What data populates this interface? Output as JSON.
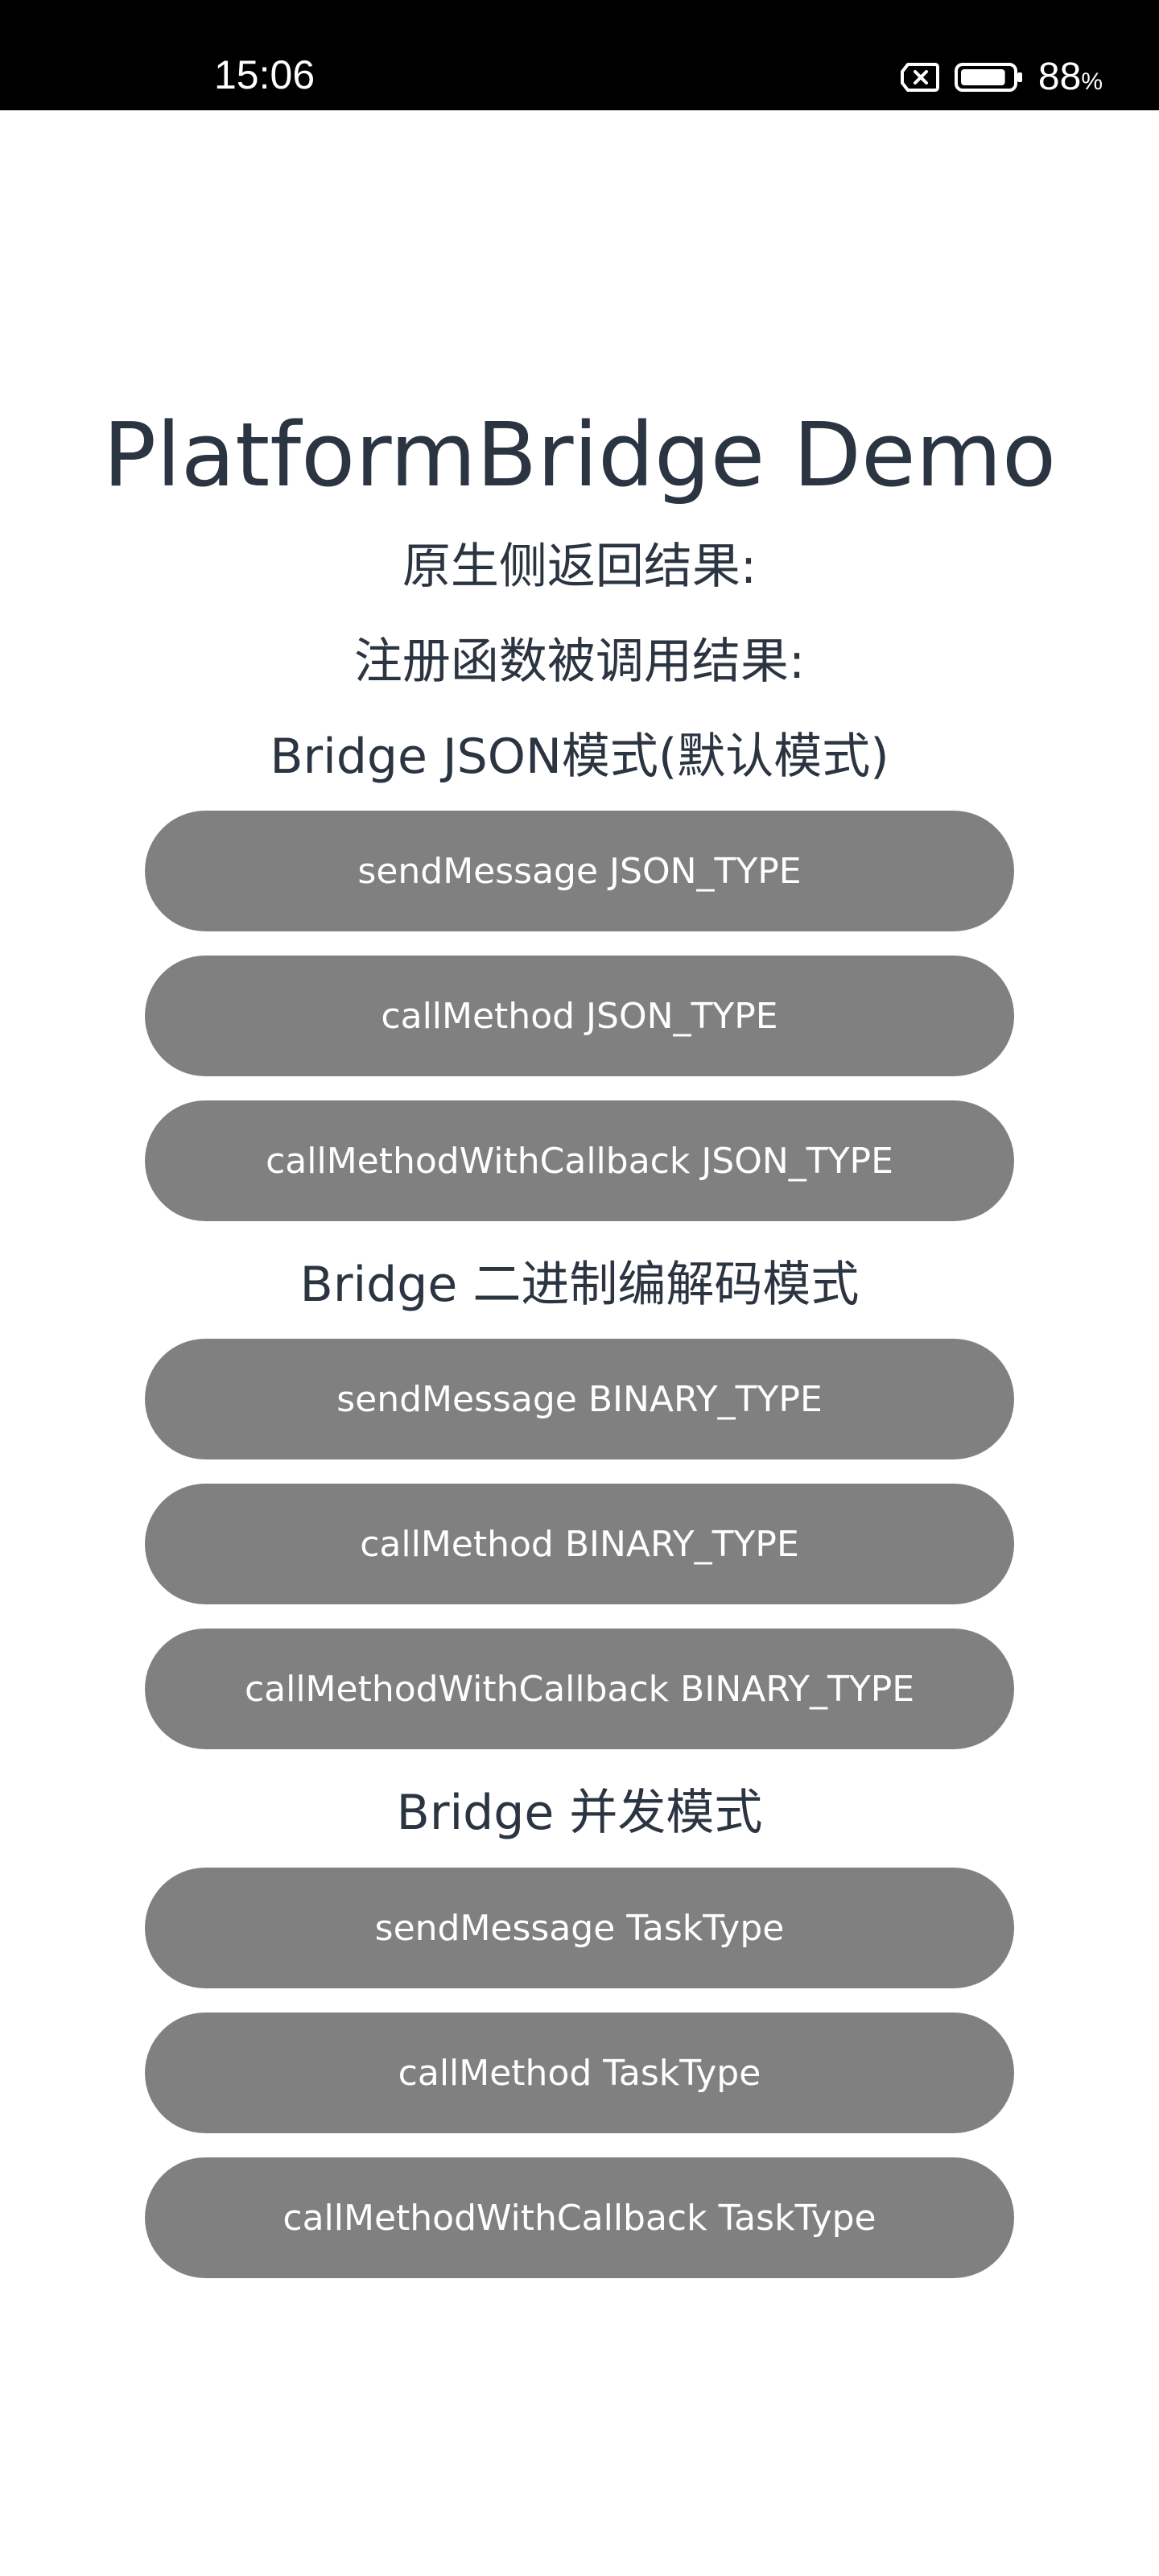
{
  "status_bar": {
    "time": "15:06",
    "battery_level": "88",
    "battery_unit": "%",
    "battery_fraction": 0.88,
    "icons": [
      "no-sim-icon",
      "battery-icon"
    ]
  },
  "page": {
    "title": "PlatformBridge Demo",
    "native_result_label": "原生侧返回结果:",
    "registered_result_label": "注册函数被调用结果:"
  },
  "sections": [
    {
      "heading": "Bridge JSON模式(默认模式)",
      "buttons": [
        "sendMessage JSON_TYPE",
        "callMethod JSON_TYPE",
        "callMethodWithCallback JSON_TYPE"
      ]
    },
    {
      "heading": "Bridge 二进制编解码模式",
      "buttons": [
        "sendMessage BINARY_TYPE",
        "callMethod BINARY_TYPE",
        "callMethodWithCallback BINARY_TYPE"
      ]
    },
    {
      "heading": "Bridge 并发模式",
      "buttons": [
        "sendMessage TaskType",
        "callMethod TaskType",
        "callMethodWithCallback TaskType"
      ]
    }
  ],
  "colors": {
    "button_bg": "#808080",
    "text": "#2b3441",
    "status_bar_bg": "#000000"
  }
}
